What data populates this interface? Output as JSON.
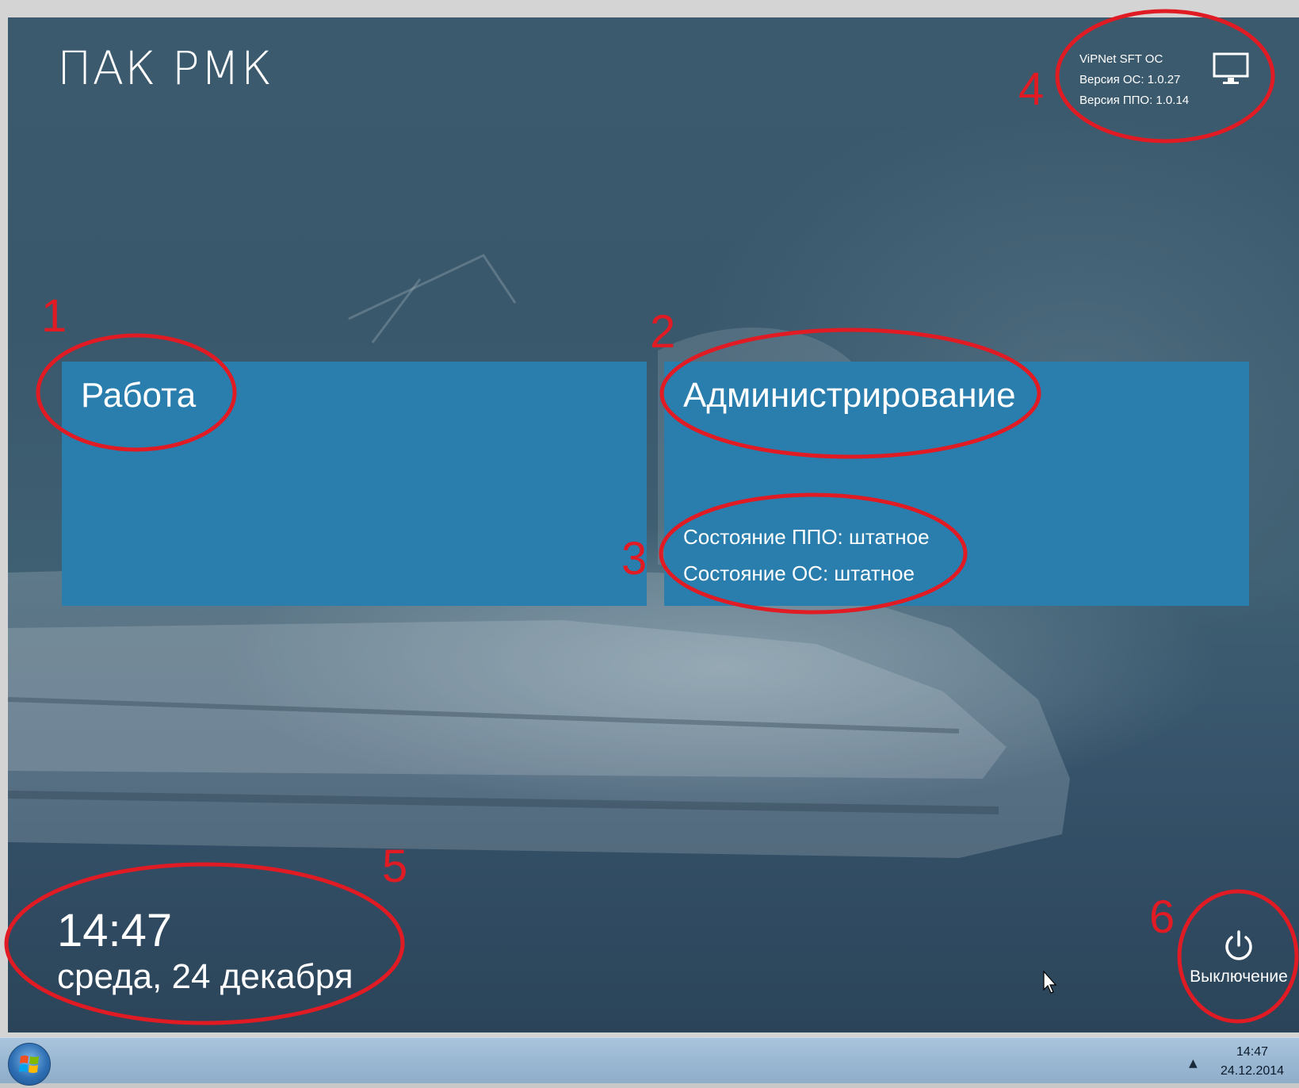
{
  "app": {
    "title": "ПАК РМК"
  },
  "sysinfo": {
    "line1": "ViPNet SFT OC",
    "line2": "Версия ОС: 1.0.27",
    "line3": "Версия ППО: 1.0.14",
    "icon": "monitor-icon"
  },
  "tiles": {
    "work": {
      "label": "Работа"
    },
    "admin": {
      "label": "Администрирование",
      "status_ppo": "Состояние ППО:  штатное",
      "status_os": "Состояние ОС:  штатное"
    }
  },
  "clock": {
    "time": "14:47",
    "date": "среда, 24 декабря"
  },
  "power": {
    "label": "Выключение",
    "icon": "power-icon"
  },
  "annotations": {
    "n1": "1",
    "n2": "2",
    "n3": "3",
    "n4": "4",
    "n5": "5",
    "n6": "6"
  },
  "taskbar": {
    "time": "14:47",
    "date": "24.12.2014",
    "start_icon": "windows-start-icon",
    "tray_icon": "show-hidden-icons-arrow"
  },
  "colors": {
    "background": "#3c5a6d",
    "tile": "#2a7ead",
    "annotation": "#e01b24",
    "taskbar": "#9bb8d3"
  }
}
